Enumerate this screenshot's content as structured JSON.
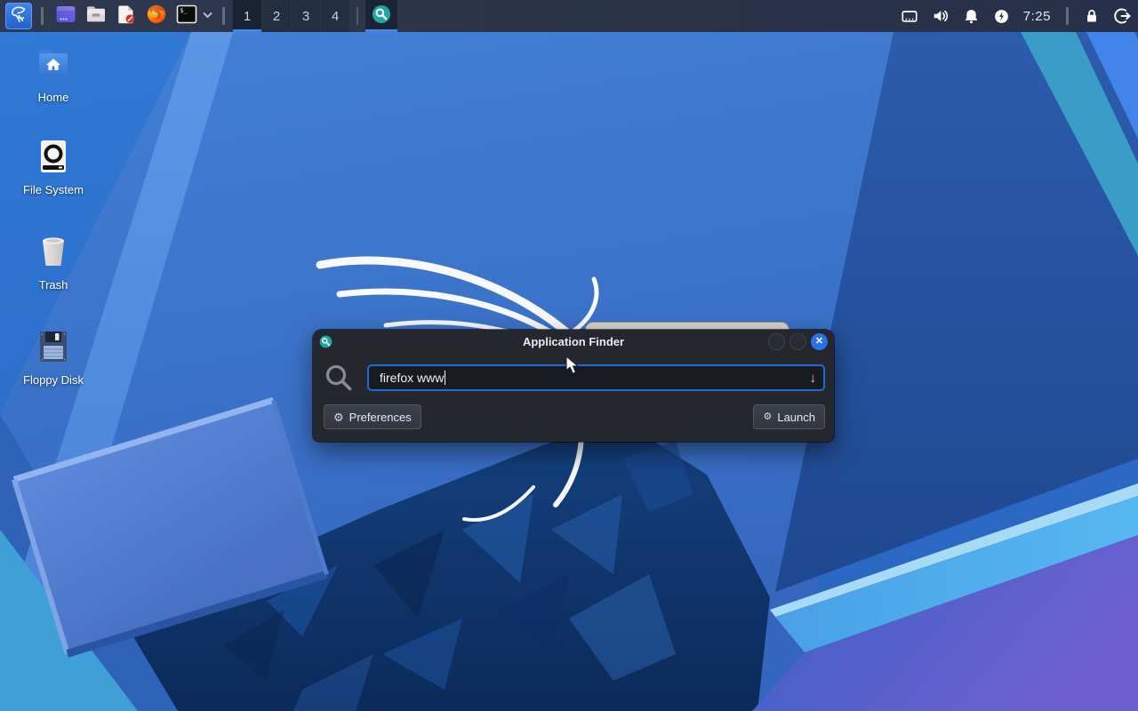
{
  "panel": {
    "launchers": [
      {
        "name": "kali-menu",
        "icon": "kali-logo-icon"
      },
      {
        "name": "app-window",
        "icon": "purple-window-icon"
      },
      {
        "name": "file-manager",
        "icon": "folder-icon"
      },
      {
        "name": "text-editor",
        "icon": "document-edit-icon"
      },
      {
        "name": "web-browser",
        "icon": "firefox-icon"
      },
      {
        "name": "terminal",
        "icon": "terminal-icon"
      }
    ],
    "workspaces": [
      "1",
      "2",
      "3",
      "4"
    ],
    "active_workspace": "1",
    "task_buttons": [
      {
        "title": "Application Finder",
        "icon": "app-finder-icon"
      }
    ],
    "status_icons": [
      "network-icon",
      "volume-icon",
      "notifications-icon",
      "power-manager-icon"
    ],
    "clock": "7:25",
    "session_icons": [
      "lock-icon",
      "logout-icon"
    ]
  },
  "desktop": {
    "icons": [
      {
        "label": "Home",
        "icon": "home-folder-icon"
      },
      {
        "label": "File System",
        "icon": "filesystem-drive-icon"
      },
      {
        "label": "Trash",
        "icon": "trash-icon"
      },
      {
        "label": "Floppy Disk",
        "icon": "floppy-disk-icon"
      }
    ]
  },
  "finder": {
    "title": "Application Finder",
    "titlebar_icon": "app-finder-icon",
    "search_value": "firefox www",
    "combo_arrow": "↓",
    "close_glyph": "✕",
    "preferences_label": "Preferences",
    "preferences_icon": "⚙",
    "launch_label": "Launch",
    "launch_icon": "⚙"
  },
  "colors": {
    "accent_blue": "#3e86e8",
    "panel_bg": "#2b3447",
    "dialog_bg": "#24272e",
    "input_border": "#1f6ad8",
    "finder_teal": "#21a6a0",
    "close_button_blue": "#2a70e8"
  }
}
